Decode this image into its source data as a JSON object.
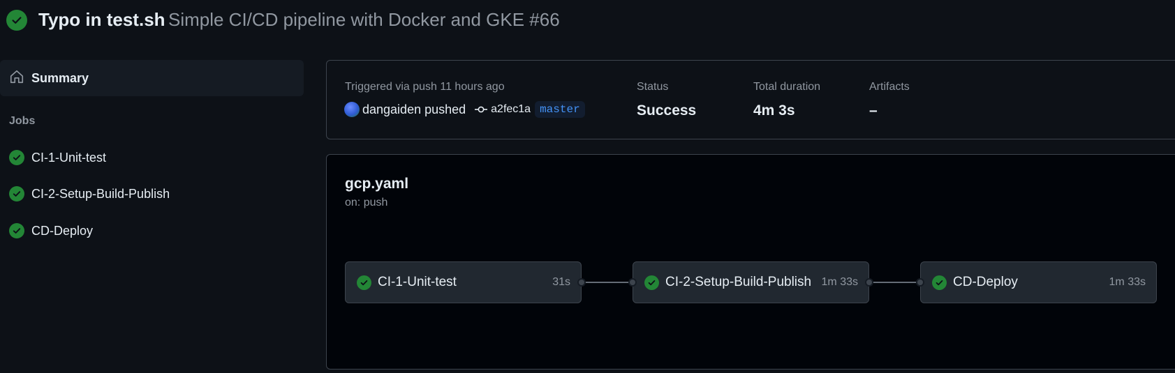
{
  "header": {
    "status_icon": "check-circle-icon",
    "commit_title": "Typo in test.sh",
    "workflow_and_run": "Simple CI/CD pipeline with Docker and GKE #66"
  },
  "sidebar": {
    "summary_label": "Summary",
    "jobs_heading": "Jobs",
    "jobs": [
      {
        "label": "CI-1-Unit-test",
        "status": "success"
      },
      {
        "label": "CI-2-Setup-Build-Publish",
        "status": "success"
      },
      {
        "label": "CD-Deploy",
        "status": "success"
      }
    ]
  },
  "run_summary": {
    "triggered_text": "Triggered via push 11 hours ago",
    "actor_text": "dangaiden pushed",
    "commit_sha": "a2fec1a",
    "branch": "master",
    "status_label": "Status",
    "status_value": "Success",
    "duration_label": "Total duration",
    "duration_value": "4m 3s",
    "artifacts_label": "Artifacts",
    "artifacts_value": "–"
  },
  "workflow_graph": {
    "file_name": "gcp.yaml",
    "trigger": "on: push",
    "jobs": [
      {
        "name": "CI-1-Unit-test",
        "duration": "31s",
        "status": "success"
      },
      {
        "name": "CI-2-Setup-Build-Publish",
        "duration": "1m 33s",
        "status": "success"
      },
      {
        "name": "CD-Deploy",
        "duration": "1m 33s",
        "status": "success"
      }
    ]
  },
  "colors": {
    "background": "#0d1117",
    "success": "#238636",
    "branch_text": "#4493f8",
    "muted_text": "#9198a1"
  }
}
